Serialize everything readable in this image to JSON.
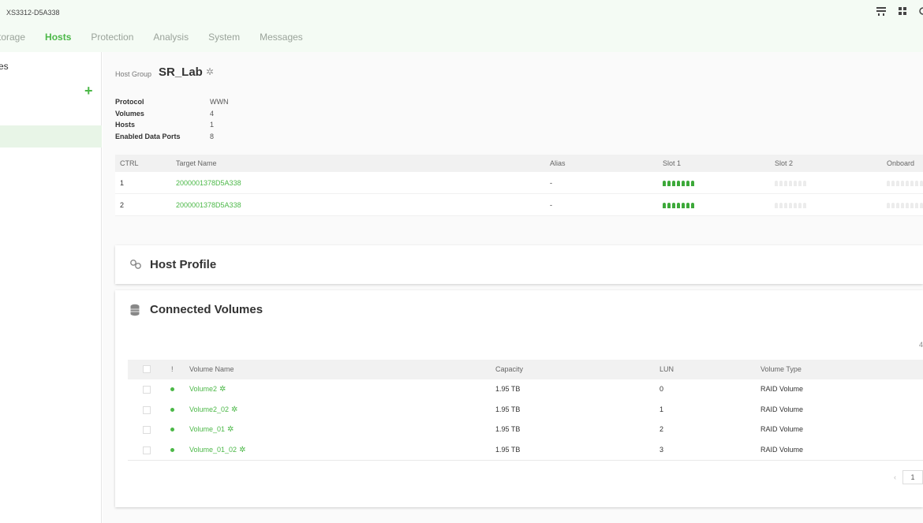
{
  "app": {
    "device_name": "XS3312-D5A338"
  },
  "top_icons": [
    "network-icon",
    "grid-icon"
  ],
  "nav": {
    "tabs": [
      {
        "label": "torage",
        "active": false
      },
      {
        "label": "Hosts",
        "active": true
      },
      {
        "label": "Protection",
        "active": false
      },
      {
        "label": "Analysis",
        "active": false
      },
      {
        "label": "System",
        "active": false
      },
      {
        "label": "Messages",
        "active": false
      }
    ]
  },
  "sidebar": {
    "title": "es",
    "add_icon": "plus-icon"
  },
  "host_group": {
    "label": "Host Group",
    "name": "SR_Lab",
    "properties": [
      {
        "key": "Protocol",
        "value": "WWN"
      },
      {
        "key": "Volumes",
        "value": "4"
      },
      {
        "key": "Hosts",
        "value": "1"
      },
      {
        "key": "Enabled Data Ports",
        "value": "8"
      }
    ]
  },
  "targets": {
    "headers": {
      "ctrl": "CTRL",
      "target": "Target Name",
      "alias": "Alias",
      "slot1": "Slot 1",
      "slot2": "Slot 2",
      "onboard": "Onboard"
    },
    "rows": [
      {
        "ctrl": "1",
        "target": "2000001378D5A338",
        "alias": "-",
        "slot1_ports": [
          1,
          1,
          1,
          1,
          1,
          1,
          1
        ],
        "slot2_ports": [
          0,
          0,
          0,
          0,
          0,
          0,
          0
        ],
        "onboard_ports": [
          0,
          0,
          0,
          0,
          0,
          0,
          0,
          0
        ]
      },
      {
        "ctrl": "2",
        "target": "2000001378D5A338",
        "alias": "-",
        "slot1_ports": [
          1,
          1,
          1,
          1,
          1,
          1,
          1
        ],
        "slot2_ports": [
          0,
          0,
          0,
          0,
          0,
          0,
          0
        ],
        "onboard_ports": [
          0,
          0,
          0,
          0,
          0,
          0,
          0,
          0
        ]
      }
    ]
  },
  "host_profile": {
    "title": "Host Profile",
    "icon": "link-icon"
  },
  "connected_volumes": {
    "title": "Connected Volumes",
    "icon": "database-icon",
    "count": "4",
    "headers": {
      "idx": "!",
      "name": "Volume Name",
      "capacity": "Capacity",
      "lun": "LUN",
      "type": "Volume Type"
    },
    "rows": [
      {
        "name": "Volume2",
        "capacity": "1.95 TB",
        "lun": "0",
        "type": "RAID Volume"
      },
      {
        "name": "Volume2_02",
        "capacity": "1.95 TB",
        "lun": "1",
        "type": "RAID Volume"
      },
      {
        "name": "Volume_01",
        "capacity": "1.95 TB",
        "lun": "2",
        "type": "RAID Volume"
      },
      {
        "name": "Volume_01_02",
        "capacity": "1.95 TB",
        "lun": "3",
        "type": "RAID Volume"
      }
    ],
    "pager": {
      "prev": "‹",
      "page": "1"
    }
  },
  "colors": {
    "accent": "#4cb848",
    "topbar_bg": "#f4fbf4"
  }
}
